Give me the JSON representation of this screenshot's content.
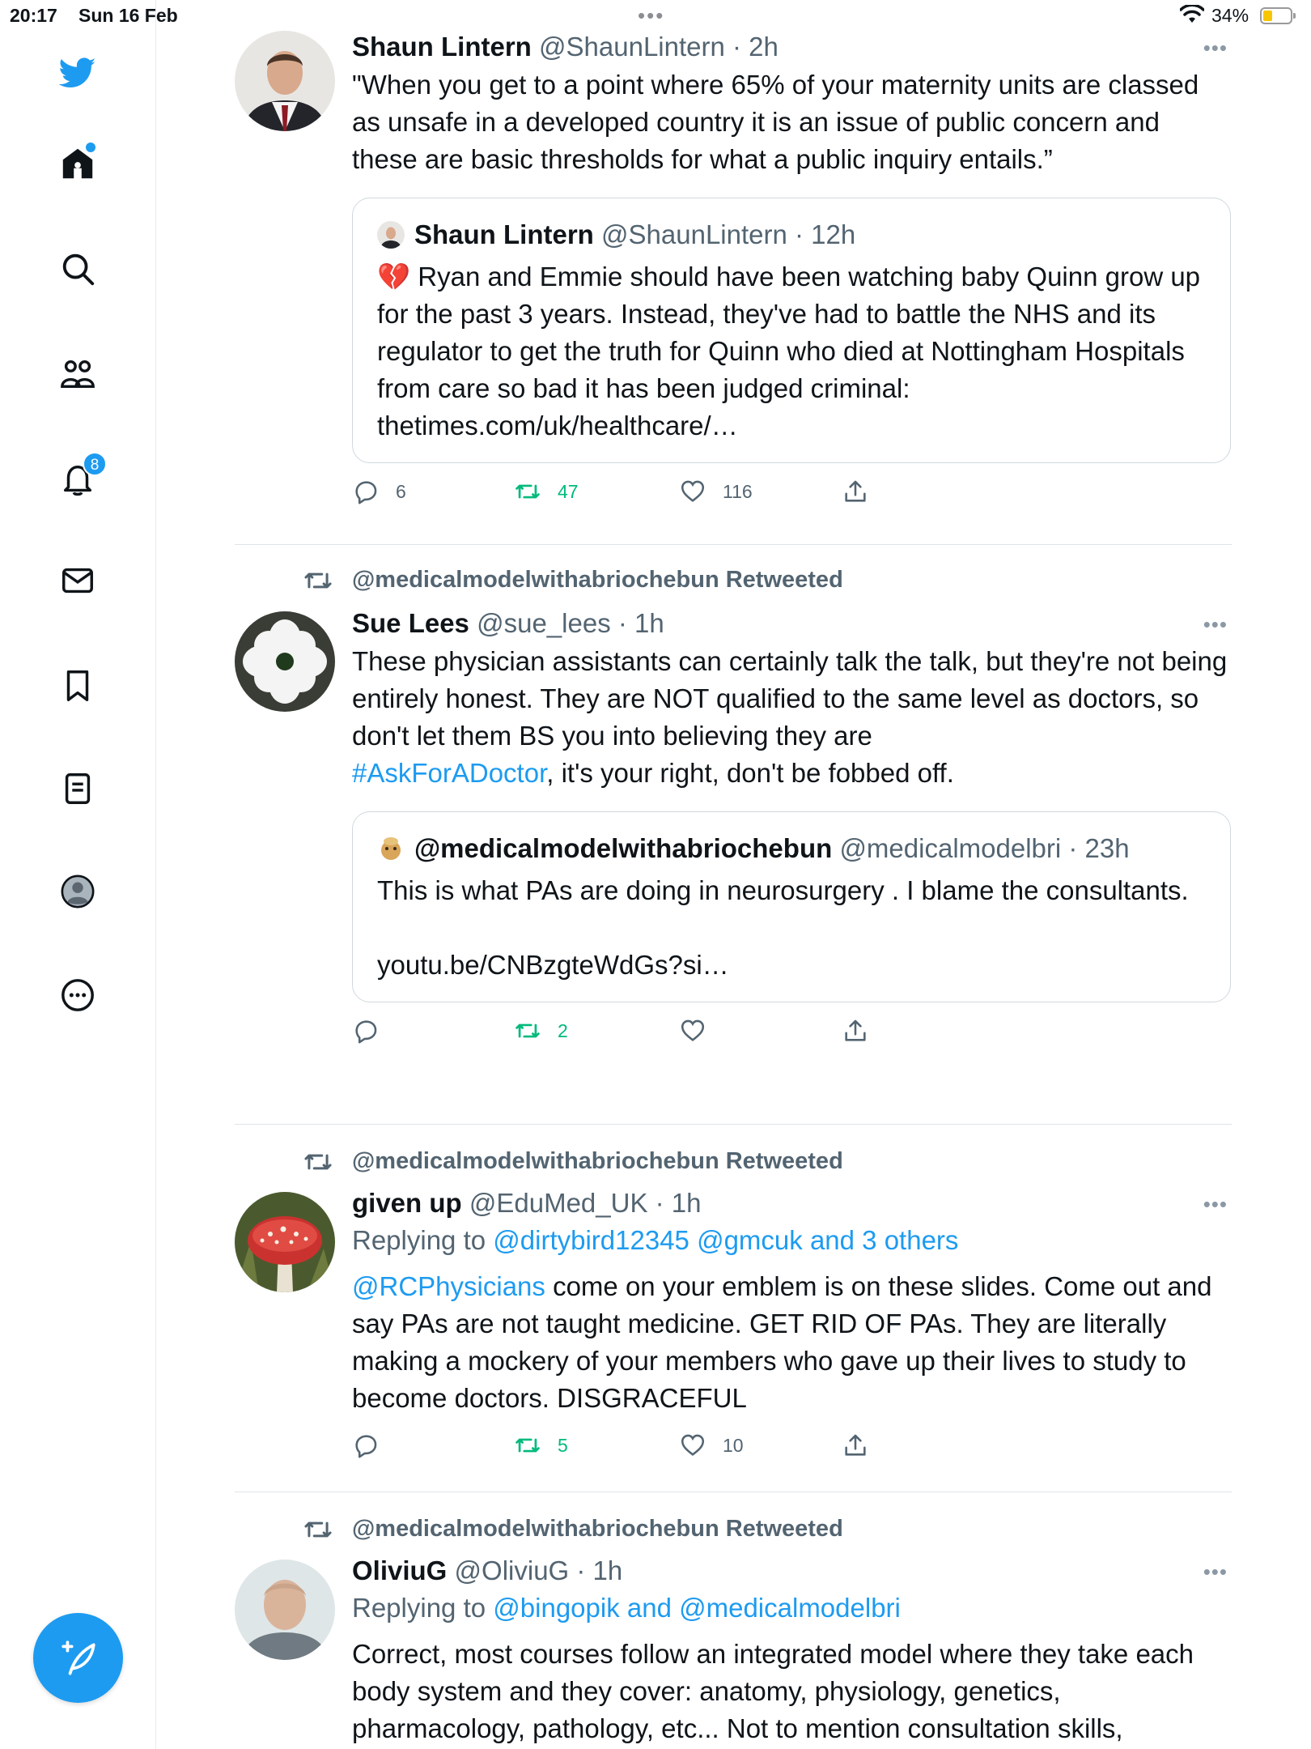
{
  "status_bar": {
    "time": "20:17",
    "date": "Sun 16 Feb",
    "battery": "34%",
    "battery_level": 0.34
  },
  "sidebar": {
    "items": [
      {
        "icon": "twitter-bird-icon"
      },
      {
        "icon": "home-icon"
      },
      {
        "icon": "search-icon"
      },
      {
        "icon": "communities-icon"
      },
      {
        "icon": "notifications-icon",
        "badge": "8"
      },
      {
        "icon": "messages-icon"
      },
      {
        "icon": "bookmarks-icon"
      },
      {
        "icon": "lists-icon"
      },
      {
        "icon": "profile-icon"
      },
      {
        "icon": "more-icon"
      }
    ],
    "compose_icon": "compose-icon"
  },
  "tweets": [
    {
      "name": "Shaun Lintern",
      "handle": "@ShaunLintern",
      "time": "· 2h",
      "text": "\"When you get to a point where 65% of your maternity units are classed as unsafe in a developed country it is an issue of public concern and these are basic thresholds for what a public inquiry entails.”",
      "quote": {
        "name": "Shaun Lintern",
        "handle": "@ShaunLintern",
        "time": "· 12h",
        "emoji": "💔",
        "text": " Ryan and Emmie should have been watching baby Quinn grow up for the past 3 years. Instead, they've had to battle the NHS and its regulator to get the truth for Quinn who died at Nottingham Hospitals from care so bad it has been judged criminal:",
        "link": "thetimes.com/uk/healthcare/…"
      },
      "replies": "6",
      "retweets": "47",
      "likes": "116"
    },
    {
      "retweeted_by": "@medicalmodelwithabriochebun Retweeted",
      "name": "Sue Lees",
      "handle": "@sue_lees",
      "time": "· 1h",
      "text": "These physician assistants can certainly talk the talk, but they're not being entirely honest. They are NOT qualified to the same level as doctors, so don't let them BS you into believing they are",
      "hashtag": "#AskForADoctor",
      "text_after": ",  it's your right, don't be fobbed off.",
      "quote": {
        "name": "@medicalmodelwithabriochebun",
        "handle": "@medicalmodelbri",
        "time": "· 23h",
        "text": "This is what PAs are doing in neurosurgery . I blame the consultants.",
        "link": "youtu.be/CNBzgteWdGs?si…"
      },
      "replies": "",
      "retweets": "2",
      "likes": ""
    },
    {
      "retweeted_by": "@medicalmodelwithabriochebun Retweeted",
      "name": "given up",
      "handle": "@EduMed_UK",
      "time": "· 1h",
      "replying_prefix": "Replying to",
      "replying_to": "@dirtybird12345 @gmcuk and 3 others",
      "mention": "@RCPhysicians",
      "text": " come on your emblem is on these slides. Come out and say PAs are not taught medicine. GET RID OF PAs. They are literally making a mockery of your members who gave up their lives to study to become doctors. DISGRACEFUL",
      "replies": "",
      "retweets": "5",
      "likes": "10"
    },
    {
      "retweeted_by": "@medicalmodelwithabriochebun Retweeted",
      "name": "OliviuG",
      "handle": "@OliviuG",
      "time": "· 1h",
      "replying_prefix": "Replying to",
      "replying_to": "@bingopik and @medicalmodelbri",
      "text": "Correct, most courses follow an integrated model where they take each body system and they cover: anatomy, physiology, genetics, pharmacology, pathology, etc... Not to mention consultation skills,"
    }
  ],
  "colors": {
    "accent": "#1d9bf0",
    "retweet_green": "#00ba7c",
    "secondary_text": "#536471"
  }
}
